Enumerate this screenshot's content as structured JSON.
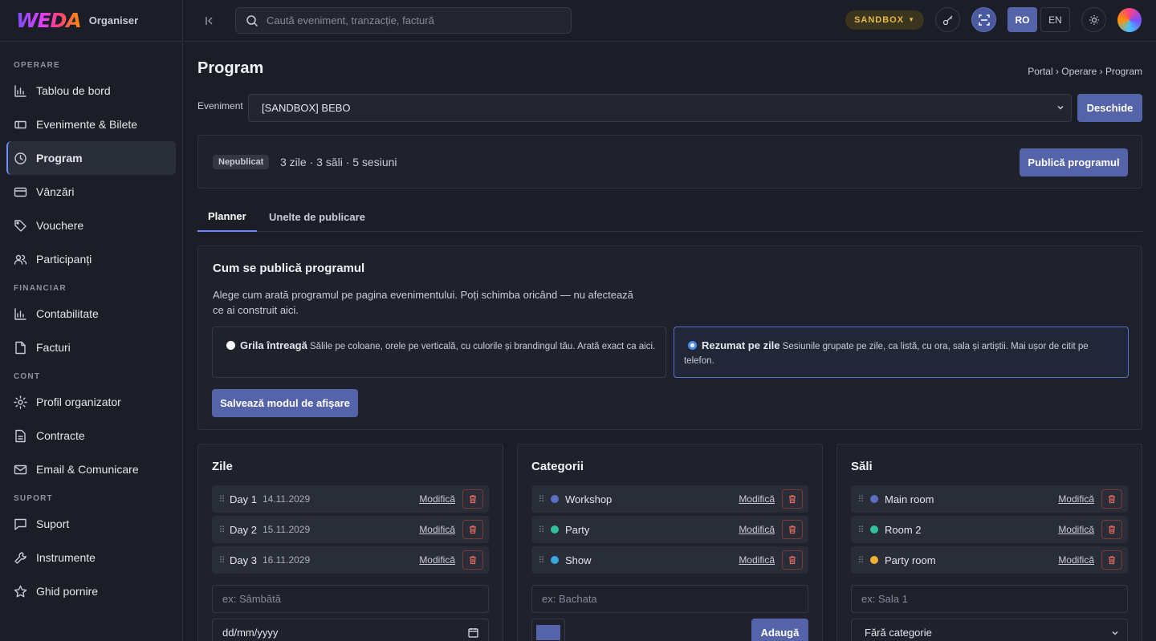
{
  "brand": {
    "logo": "WEDA",
    "subtitle": "Organiser"
  },
  "sidebar": {
    "sections": [
      {
        "title": "OPERARE",
        "items": [
          {
            "label": "Tablou de bord",
            "icon": "bar-chart-icon"
          },
          {
            "label": "Evenimente & Bilete",
            "icon": "ticket-icon"
          },
          {
            "label": "Program",
            "icon": "clock-icon",
            "active": true
          },
          {
            "label": "Vânzări",
            "icon": "card-icon"
          },
          {
            "label": "Vouchere",
            "icon": "tag-icon"
          },
          {
            "label": "Participanți",
            "icon": "users-icon"
          }
        ]
      },
      {
        "title": "FINANCIAR",
        "items": [
          {
            "label": "Contabilitate",
            "icon": "bar-chart-icon"
          },
          {
            "label": "Facturi",
            "icon": "document-icon"
          }
        ]
      },
      {
        "title": "CONT",
        "items": [
          {
            "label": "Profil organizator",
            "icon": "gear-icon"
          },
          {
            "label": "Contracte",
            "icon": "contract-icon"
          },
          {
            "label": "Email & Comunicare",
            "icon": "mail-icon"
          }
        ]
      },
      {
        "title": "SUPORT",
        "items": [
          {
            "label": "Suport",
            "icon": "chat-icon"
          },
          {
            "label": "Instrumente",
            "icon": "wrench-icon"
          },
          {
            "label": "Ghid pornire",
            "icon": "star-icon"
          }
        ]
      }
    ]
  },
  "topbar": {
    "search_placeholder": "Caută eveniment, tranzacție, factură",
    "sandbox_label": "SANDBOX",
    "lang_active": "RO",
    "lang_other": "EN"
  },
  "page": {
    "title": "Program",
    "breadcrumb": "Portal › Operare › Program",
    "event_label": "Eveniment",
    "event_value": "[SANDBOX] BEBO",
    "open_button": "Deschide",
    "status_badge": "Nepublicat",
    "status_summary": "3 zile · 3 săli · 5 sesiuni",
    "publish_button": "Publică programul",
    "tabs": [
      "Planner",
      "Unelte de publicare"
    ]
  },
  "display_mode": {
    "title": "Cum se publică programul",
    "description": "Alege cum arată programul pe pagina evenimentului. Poți schimba oricând — nu afectează ce ai construit aici.",
    "options": [
      {
        "name": "Grila întreagă",
        "text": "Sălile pe coloane, orele pe verticală, cu culorile și brandingul tău. Arată exact ca aici.",
        "selected": false
      },
      {
        "name": "Rezumat pe zile",
        "text": "Sesiunile grupate pe zile, ca listă, cu ora, sala și artiștii. Mai ușor de citit pe telefon.",
        "selected": true
      }
    ],
    "save_button": "Salvează modul de afișare"
  },
  "days": {
    "title": "Zile",
    "items": [
      {
        "name": "Day 1",
        "date": "14.11.2029"
      },
      {
        "name": "Day 2",
        "date": "15.11.2029"
      },
      {
        "name": "Day 3",
        "date": "16.11.2029"
      }
    ],
    "edit_label": "Modifică",
    "name_placeholder": "ex: Sâmbătă",
    "date_placeholder": "dd/mm/yyyy"
  },
  "categories": {
    "title": "Categorii",
    "items": [
      {
        "name": "Workshop",
        "color": "#5b6fc4"
      },
      {
        "name": "Party",
        "color": "#2fc19a"
      },
      {
        "name": "Show",
        "color": "#3aa7e0"
      }
    ],
    "edit_label": "Modifică",
    "name_placeholder": "ex: Bachata",
    "swatch_color": "#5563a8",
    "add_button": "Adaugă"
  },
  "rooms": {
    "title": "Săli",
    "items": [
      {
        "name": "Main room",
        "color": "#5b6fc4"
      },
      {
        "name": "Room 2",
        "color": "#2fc19a"
      },
      {
        "name": "Party room",
        "color": "#f2b135"
      }
    ],
    "edit_label": "Modifică",
    "name_placeholder": "ex: Sala 1",
    "category_select": "Fără categorie"
  }
}
